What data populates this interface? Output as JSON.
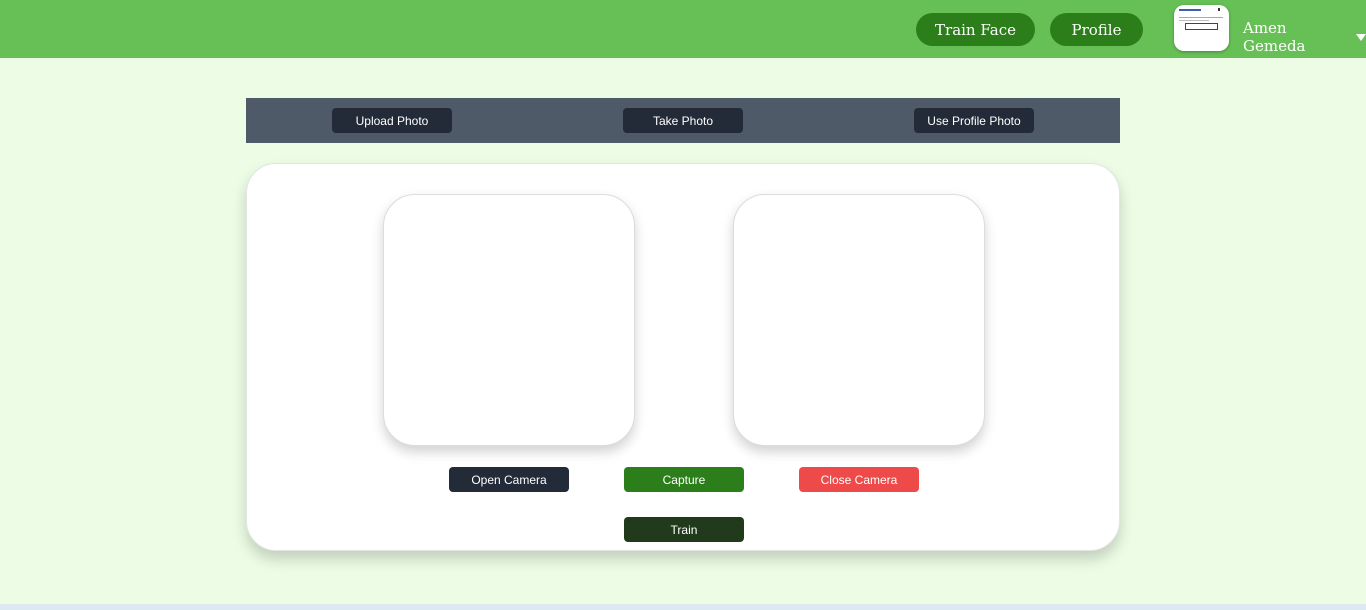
{
  "nav": {
    "train_face_label": "Train Face",
    "profile_label": "Profile",
    "user_name": "Amen Gemeda"
  },
  "toolbar": {
    "upload_label": "Upload Photo",
    "take_label": "Take Photo",
    "profile_photo_label": "Use Profile Photo"
  },
  "actions": {
    "open_camera_label": "Open Camera",
    "capture_label": "Capture",
    "close_camera_label": "Close Camera",
    "train_label": "Train"
  },
  "colors": {
    "header_bg": "#67c056",
    "page_bg": "#ecfce5",
    "accent_green": "#2b7e1a",
    "dark_button": "#232a38",
    "danger": "#ef4a4a",
    "toolbar_bg": "#4f5a69"
  },
  "icons": {
    "user_menu": "caret-down-icon"
  }
}
